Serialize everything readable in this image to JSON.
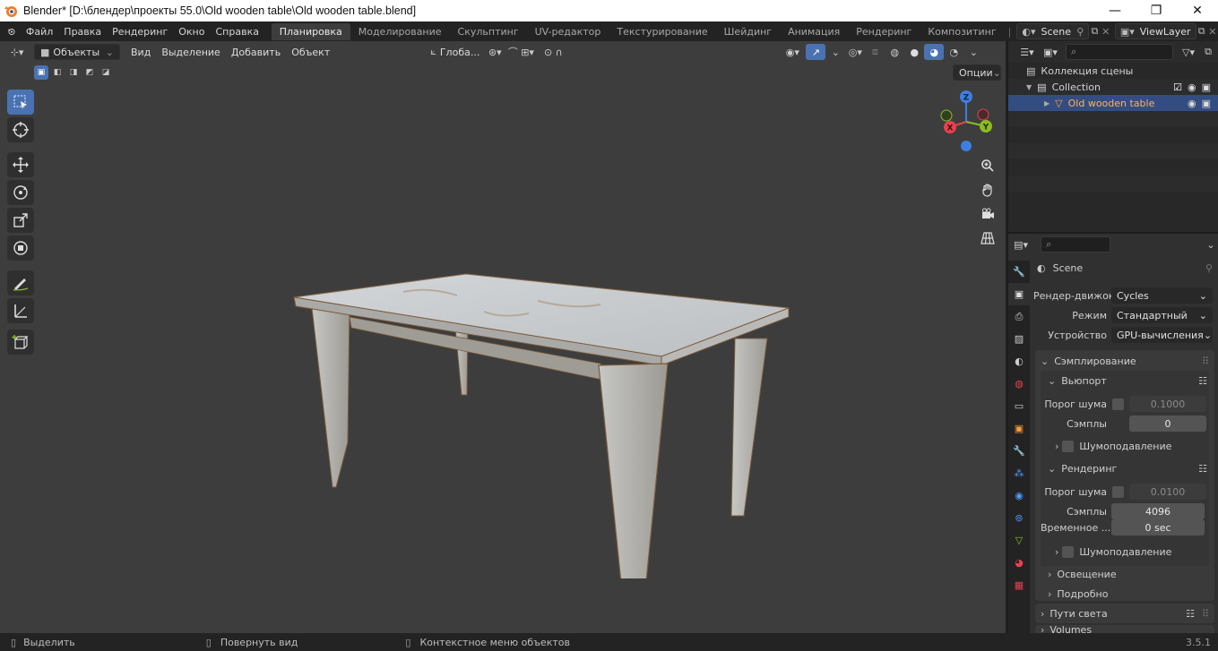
{
  "window": {
    "title": "Blender* [D:\\блендер\\проекты 55.0\\Old wooden table\\Old wooden table.blend]",
    "controls": {
      "minimize": "—",
      "maximize": "❐",
      "close": "✕"
    }
  },
  "topbar": {
    "menus": [
      "Файл",
      "Правка",
      "Рендеринг",
      "Окно",
      "Справка"
    ],
    "workspaces": [
      "Планировка",
      "Моделирование",
      "Скульптинг",
      "UV-редактор",
      "Текстурирование",
      "Шейдинг",
      "Анимация",
      "Рендеринг",
      "Композитинг"
    ],
    "active_workspace": "Планировка",
    "scene": "Scene",
    "view_layer": "ViewLayer"
  },
  "viewport": {
    "mode": "Объекты",
    "menus": [
      "Вид",
      "Выделение",
      "Добавить",
      "Объект"
    ],
    "transform_orientation": "Глоба...",
    "options_label": "Опции",
    "gizmo_axes": {
      "z": "Z",
      "y": "Y",
      "x": "X"
    }
  },
  "outliner": {
    "search_placeholder": "",
    "root": "Коллекция сцены",
    "collection": "Collection",
    "object": "Old wooden table"
  },
  "properties": {
    "scene_name": "Scene",
    "render_engine_label": "Рендер-движок",
    "render_engine": "Cycles",
    "mode_label": "Режим",
    "mode": "Стандартный",
    "device_label": "Устройство",
    "device": "GPU-вычисления",
    "sampling_title": "Сэмплирование",
    "viewport_title": "Вьюпорт",
    "noise_threshold_label": "Порог шума",
    "viewport_noise_threshold": "0.1000",
    "samples_label": "Сэмплы",
    "viewport_samples": "0",
    "denoise_label": "Шумоподавление",
    "render_title": "Рендеринг",
    "render_noise_threshold": "0.0100",
    "render_samples": "4096",
    "time_limit_label": "Временное ...",
    "time_limit": "0 sec",
    "lights_title": "Освещение",
    "advanced_title": "Подробно",
    "light_paths_title": "Пути света",
    "volumes_title": "Volumes"
  },
  "statusbar": {
    "select": "Выделить",
    "rotate_view": "Повернуть вид",
    "context_menu": "Контекстное меню объектов",
    "version": "3.5.1"
  },
  "colors": {
    "accent": "#4a72b2",
    "selection_text": "#ffb34d",
    "axis_x": "#e8414e",
    "axis_y": "#8cbd22",
    "axis_z": "#3e7fe0"
  }
}
